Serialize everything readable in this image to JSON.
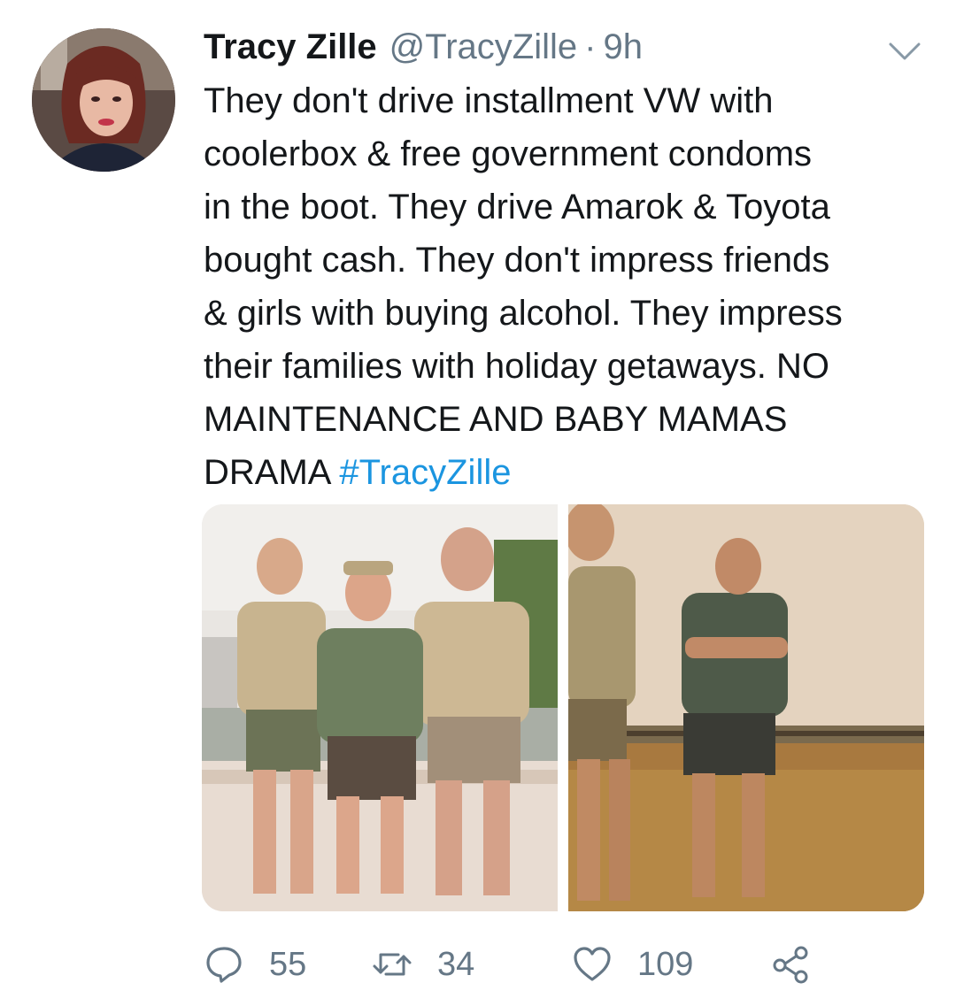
{
  "tweet": {
    "author_name": "Tracy Zille",
    "handle": "@TracyZille",
    "separator": "·",
    "time": "9h",
    "lines": [
      "They don't drive installment VW with",
      "coolerbox & free government condoms",
      "in the boot. They drive Amarok & Toyota",
      "bought cash. They don't impress friends",
      "& girls with buying alcohol. They impress",
      "their families with holiday getaways. NO",
      "MAINTENANCE AND BABY MAMAS"
    ],
    "last_line_text": "DRAMA ",
    "hashtag": "#TracyZille"
  },
  "actions": {
    "reply_icon": "reply-icon",
    "reply_count": "55",
    "retweet_icon": "retweet-icon",
    "retweet_count": "34",
    "like_icon": "heart-icon",
    "like_count": "109",
    "share_icon": "share-icon"
  },
  "colors": {
    "text": "#14171a",
    "secondary": "#657786",
    "link": "#1b95e0"
  }
}
